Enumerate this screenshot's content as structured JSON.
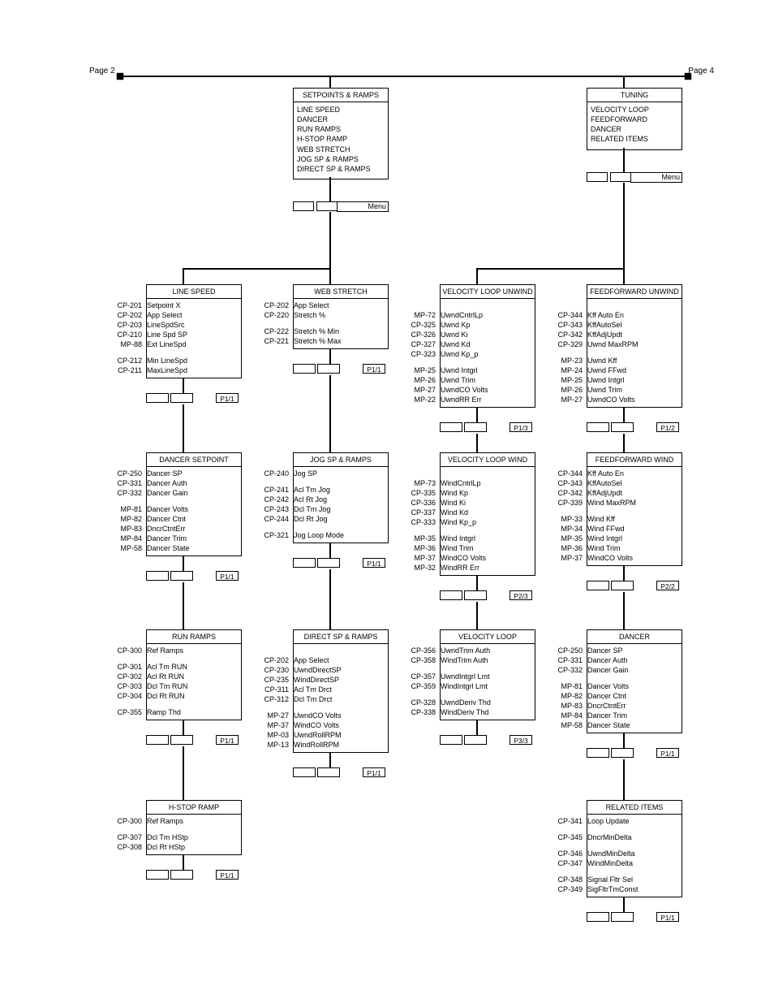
{
  "pageLeft": "Page 2",
  "pageRight": "Page 4",
  "menuLabel": "Menu",
  "menu1": {
    "title": "SETPOINTS & RAMPS",
    "items": [
      "LINE SPEED",
      "DANCER",
      "RUN RAMPS",
      "H-STOP RAMP",
      "WEB STRETCH",
      "JOG SP & RAMPS",
      "DIRECT SP & RAMPS"
    ]
  },
  "menu2": {
    "title": "TUNING",
    "items": [
      "VELOCITY LOOP",
      "FEEDFORWARD",
      "DANCER",
      "RELATED ITEMS"
    ]
  },
  "cols": [
    [
      {
        "title": "LINE SPEED",
        "pager": "P1/1",
        "rows": [
          [
            "CP-201",
            "Setpoint X"
          ],
          [
            "CP-202",
            "App Select"
          ],
          [
            "CP-203",
            "LineSpdSrc"
          ],
          [
            "CP-210",
            "Line Spd SP"
          ],
          [
            "MP-88",
            "Ext LineSpd"
          ],
          [
            "",
            ""
          ],
          [
            "CP-212",
            "Min LineSpd"
          ],
          [
            "CP-211",
            "MaxLineSpd"
          ]
        ]
      },
      {
        "title": "DANCER SETPOINT",
        "pager": "P1/1",
        "rows": [
          [
            "CP-250",
            "Dancer SP"
          ],
          [
            "CP-331",
            "Dancer Auth"
          ],
          [
            "CP-332",
            "Dancer Gain"
          ],
          [
            "",
            ""
          ],
          [
            "MP-81",
            "Dancer Volts"
          ],
          [
            "MP-82",
            "Dancer Ctnt"
          ],
          [
            "MP-83",
            "DncrCtntErr"
          ],
          [
            "MP-84",
            "Dancer Trim"
          ],
          [
            "MP-58",
            "Dancer State"
          ]
        ]
      },
      {
        "title": "RUN RAMPS",
        "pager": "P1/1",
        "rows": [
          [
            "CP-300",
            "Ref Ramps"
          ],
          [
            "",
            ""
          ],
          [
            "CP-301",
            "Acl Tm RUN"
          ],
          [
            "CP-302",
            "Acl Rt RUN"
          ],
          [
            "CP-303",
            "Dcl Tm RUN"
          ],
          [
            "CP-304",
            "Dcl Rt RUN"
          ],
          [
            "",
            ""
          ],
          [
            "CP-355",
            "Ramp Thd"
          ]
        ]
      },
      {
        "title": "H-STOP RAMP",
        "pager": "P1/1",
        "rows": [
          [
            "CP-300",
            "Ref Ramps"
          ],
          [
            "",
            ""
          ],
          [
            "CP-307",
            "Dcl Tm HStp"
          ],
          [
            "CP-308",
            "Dcl Rt HStp"
          ]
        ]
      }
    ],
    [
      {
        "title": "WEB STRETCH",
        "pager": "P1/1",
        "rows": [
          [
            "CP-202",
            "App Select"
          ],
          [
            "CP-220",
            "Stretch %"
          ],
          [
            "",
            ""
          ],
          [
            "CP-222",
            "Stretch % Min"
          ],
          [
            "CP-221",
            "Stretch % Max"
          ]
        ]
      },
      {
        "title": "JOG SP & RAMPS",
        "pager": "P1/1",
        "rows": [
          [
            "CP-240",
            "Jog SP"
          ],
          [
            "",
            ""
          ],
          [
            "CP-241",
            "Acl Tm Jog"
          ],
          [
            "CP-242",
            "Acl Rt Jog"
          ],
          [
            "CP-243",
            "Dcl Tm Jog"
          ],
          [
            "CP-244",
            "Dcl Rt Jog"
          ],
          [
            "",
            ""
          ],
          [
            "CP-321",
            "Jog Loop Mode"
          ]
        ]
      },
      {
        "title": "DIRECT SP & RAMPS",
        "pager": "P1/1",
        "rows": [
          [
            "CP-202",
            "App Select"
          ],
          [
            "CP-230",
            "UwndDirectSP"
          ],
          [
            "CP-235",
            "WindDirectSP"
          ],
          [
            "CP-311",
            "Acl Tm Drct"
          ],
          [
            "CP-312",
            "Dcl Tm Drct"
          ],
          [
            "",
            ""
          ],
          [
            "MP-27",
            "UwndCO Volts"
          ],
          [
            "MP-37",
            "WindCO Volts"
          ],
          [
            "MP-03",
            "UwndRollRPM"
          ],
          [
            "MP-13",
            "WindRollRPM"
          ]
        ]
      }
    ],
    [
      {
        "title": "VELOCITY LOOP UNWIND",
        "pager": "P1/3",
        "rows": [
          [
            "MP-72",
            "UwndCntrlLp"
          ],
          [
            "CP-325",
            "Uwnd Kp"
          ],
          [
            "CP-326",
            "Uwnd Ki"
          ],
          [
            "CP-327",
            "Uwnd Kd"
          ],
          [
            "CP-323",
            "Uwnd Kp_p"
          ],
          [
            "",
            ""
          ],
          [
            "MP-25",
            "Uwnd Intgrl"
          ],
          [
            "MP-26",
            "Uwnd Trim"
          ],
          [
            "MP-27",
            "UwndCO Volts"
          ],
          [
            "MP-22",
            "UwndRR Err"
          ]
        ]
      },
      {
        "title": "VELOCITY LOOP WIND",
        "pager": "P2/3",
        "rows": [
          [
            "MP-73",
            "WindCntrlLp"
          ],
          [
            "CP-335",
            "Wind Kp"
          ],
          [
            "CP-336",
            "Wind Ki"
          ],
          [
            "CP-337",
            "Wind Kd"
          ],
          [
            "CP-333",
            "Wind Kp_p"
          ],
          [
            "",
            ""
          ],
          [
            "MP-35",
            "Wind Intgrl"
          ],
          [
            "MP-36",
            "Wind Trim"
          ],
          [
            "MP-37",
            "WindCO Volts"
          ],
          [
            "MP-32",
            "WindRR Err"
          ]
        ]
      },
      {
        "title": "VELOCITY LOOP",
        "pager": "P3/3",
        "rows": [
          [
            "CP-356",
            "UwndTrim Auth"
          ],
          [
            "CP-358",
            "WindTrim Auth"
          ],
          [
            "",
            ""
          ],
          [
            "CP-357",
            "UwndIntgrl Lmt"
          ],
          [
            "CP-359",
            "WindIntgrl Lmt"
          ],
          [
            "",
            ""
          ],
          [
            "CP-328",
            "UwndDeriv Thd"
          ],
          [
            "CP-338",
            "WindDeriv Thd"
          ]
        ]
      }
    ],
    [
      {
        "title": "FEEDFORWARD UNWIND",
        "pager": "P1/2",
        "rows": [
          [
            "CP-344",
            "Kff Auto En"
          ],
          [
            "CP-343",
            "KffAutoSel"
          ],
          [
            "CP-342",
            "KffAdjUpdt"
          ],
          [
            "CP-329",
            "Uwnd MaxRPM"
          ],
          [
            "",
            ""
          ],
          [
            "MP-23",
            "Uwnd Kff"
          ],
          [
            "MP-24",
            "Uwnd FFwd"
          ],
          [
            "MP-25",
            "Uwnd Intgrl"
          ],
          [
            "MP-26",
            "Uwnd Trim"
          ],
          [
            "MP-27",
            "UwndCO Volts"
          ]
        ]
      },
      {
        "title": "FEEDFORWARD WIND",
        "pager": "P2/2",
        "rows": [
          [
            "CP-344",
            "Kff Auto En"
          ],
          [
            "CP-343",
            "KffAutoSel"
          ],
          [
            "CP-342",
            "KffAdjUpdt"
          ],
          [
            "CP-339",
            "Wind MaxRPM"
          ],
          [
            "",
            ""
          ],
          [
            "MP-33",
            "Wind Kff"
          ],
          [
            "MP-34",
            "Wind FFwd"
          ],
          [
            "MP-35",
            "Wind Intgrl"
          ],
          [
            "MP-36",
            "Wind Trim"
          ],
          [
            "MP-37",
            "WindCO Volts"
          ]
        ]
      },
      {
        "title": "DANCER",
        "pager": "P1/1",
        "rows": [
          [
            "CP-250",
            "Dancer SP"
          ],
          [
            "CP-331",
            "Dancer Auth"
          ],
          [
            "CP-332",
            "Dancer Gain"
          ],
          [
            "",
            ""
          ],
          [
            "MP-81",
            "Dancer Volts"
          ],
          [
            "MP-82",
            "Dancer Ctnt"
          ],
          [
            "MP-83",
            "DncrCtntErr"
          ],
          [
            "MP-84",
            "Dancer Trim"
          ],
          [
            "MP-58",
            "Dancer State"
          ]
        ]
      },
      {
        "title": "RELATED ITEMS",
        "pager": "P1/1",
        "rows": [
          [
            "CP-341",
            "Loop Update"
          ],
          [
            "",
            ""
          ],
          [
            "CP-345",
            "DncrMinDelta"
          ],
          [
            "",
            ""
          ],
          [
            "CP-346",
            "UwndMinDelta"
          ],
          [
            "CP-347",
            "WindMinDelta"
          ],
          [
            "",
            ""
          ],
          [
            "CP-348",
            "Signal Fltr Sel"
          ],
          [
            "CP-349",
            "SigFltrTmConst"
          ]
        ]
      }
    ]
  ]
}
